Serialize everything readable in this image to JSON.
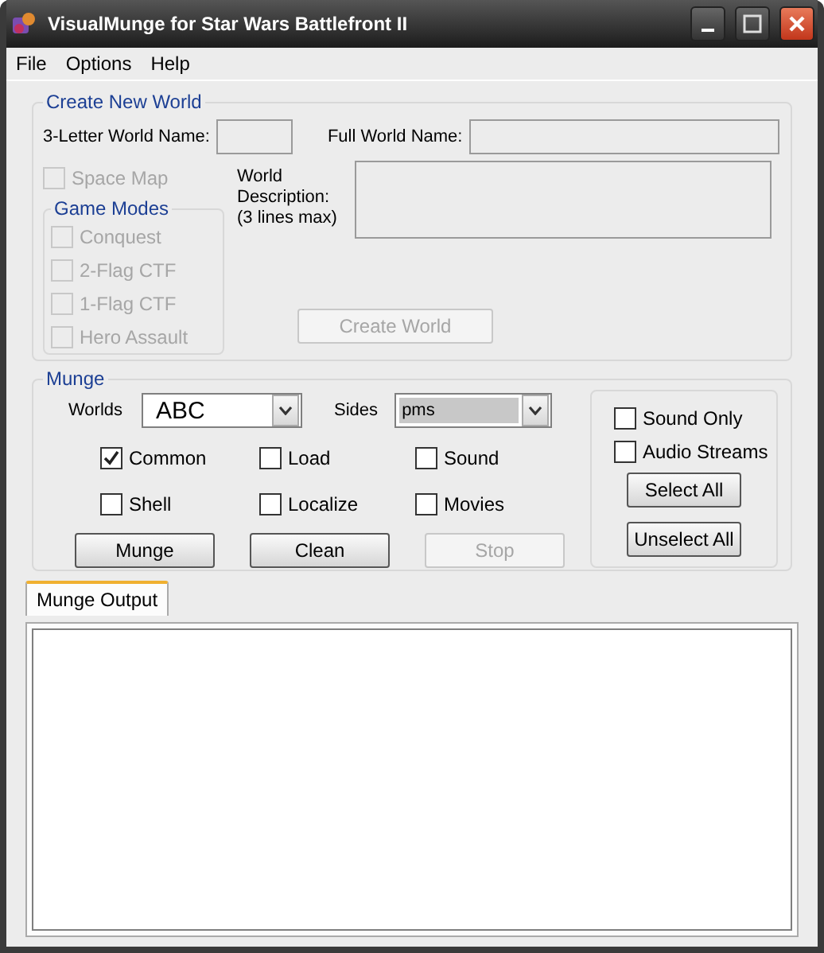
{
  "window": {
    "title": "VisualMunge for Star Wars Battlefront II"
  },
  "menu": [
    "File",
    "Options",
    "Help"
  ],
  "create_world": {
    "title": "Create New World",
    "short_name": {
      "label": "3-Letter World Name:",
      "disabled": true
    },
    "full_name": {
      "label": "Full World Name:",
      "disabled": true
    },
    "space_map": {
      "label": "Space Map",
      "checked": false,
      "disabled": true
    },
    "game_modes": {
      "title": "Game Modes",
      "options": [
        {
          "label": "Conquest",
          "checked": false,
          "disabled": true
        },
        {
          "label": "2-Flag CTF",
          "checked": false,
          "disabled": true
        },
        {
          "label": "1-Flag CTF",
          "checked": false,
          "disabled": true
        },
        {
          "label": "Hero Assault",
          "checked": false,
          "disabled": true
        }
      ]
    },
    "description": {
      "label_lines": [
        "World",
        "Description:",
        "(3 lines max)"
      ],
      "disabled": true
    },
    "button": {
      "label": "Create World",
      "disabled": true
    }
  },
  "munge": {
    "title": "Munge",
    "worlds": {
      "label": "Worlds",
      "value": "ABC"
    },
    "sides": {
      "label": "Sides",
      "value": "pms"
    },
    "options": [
      {
        "label": "Common",
        "checked": true
      },
      {
        "label": "Load",
        "checked": false
      },
      {
        "label": "Sound",
        "checked": false
      },
      {
        "label": "Shell",
        "checked": false
      },
      {
        "label": "Localize",
        "checked": false
      },
      {
        "label": "Movies",
        "checked": false
      }
    ],
    "buttons": [
      {
        "label": "Munge",
        "disabled": false
      },
      {
        "label": "Clean",
        "disabled": false
      },
      {
        "label": "Stop",
        "disabled": true
      }
    ],
    "side_options": [
      {
        "label": "Sound Only",
        "checked": false
      },
      {
        "label": "Audio Streams",
        "checked": false
      }
    ],
    "side_buttons": [
      {
        "label": "Select All",
        "disabled": false
      },
      {
        "label": "Unselect All",
        "disabled": false
      }
    ]
  },
  "output": {
    "tabs": [
      {
        "label": "Munge Output",
        "selected": true
      }
    ]
  }
}
